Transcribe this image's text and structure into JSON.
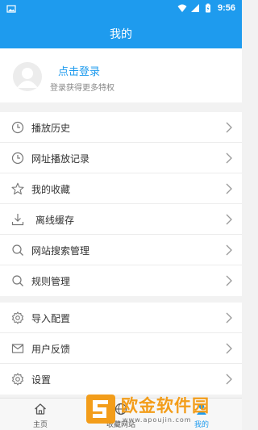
{
  "status_bar": {
    "time": "9:56"
  },
  "header": {
    "title": "我的"
  },
  "profile": {
    "login_label": "点击登录",
    "hint": "登录获得更多特权"
  },
  "menu": {
    "group1": [
      {
        "label": "播放历史",
        "icon": "clock-icon"
      },
      {
        "label": "网址播放记录",
        "icon": "clock-icon"
      },
      {
        "label": "我的收藏",
        "icon": "star-icon"
      },
      {
        "label": "离线缓存",
        "icon": "download-icon"
      },
      {
        "label": "网站搜索管理",
        "icon": "search-icon"
      },
      {
        "label": "规则管理",
        "icon": "search-icon"
      }
    ],
    "group2": [
      {
        "label": "导入配置",
        "icon": "gear-icon"
      },
      {
        "label": "用户反馈",
        "icon": "mail-icon"
      },
      {
        "label": "设置",
        "icon": "gear-icon"
      }
    ]
  },
  "tabs": [
    {
      "label": "主页",
      "icon": "home-icon"
    },
    {
      "label": "收藏网站",
      "icon": "globe-icon"
    },
    {
      "label": "我的",
      "icon": "person-icon"
    }
  ],
  "watermark": {
    "text": "欧金软件园",
    "url": "www.apoujin.com"
  },
  "colors": {
    "accent": "#1e9bee",
    "watermark": "#f39a12"
  }
}
